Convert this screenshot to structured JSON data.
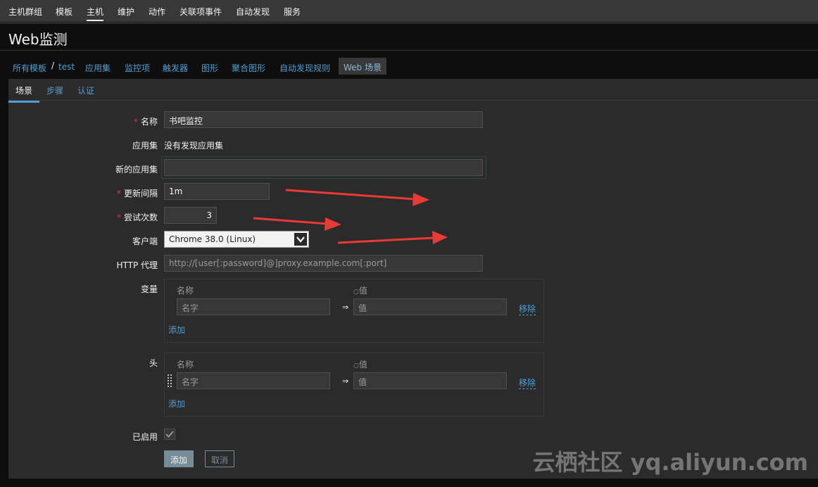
{
  "topnav": {
    "items": [
      "主机群组",
      "模板",
      "主机",
      "维护",
      "动作",
      "关联项事件",
      "自动发现",
      "服务"
    ],
    "active": "主机"
  },
  "page": {
    "title": "Web监测"
  },
  "breadcrumb": {
    "all_templates": "所有模板",
    "separator": "/",
    "current": "test",
    "links": [
      "应用集",
      "监控项",
      "触发器",
      "图形",
      "聚合图形",
      "自动发现规则"
    ],
    "active": "Web 场景"
  },
  "tabs": [
    "场景",
    "步骤",
    "认证"
  ],
  "form": {
    "name_label": "名称",
    "name_value": "书吧监控",
    "appset_label": "应用集",
    "appset_value": "没有发现应用集",
    "new_appset_label": "新的应用集",
    "new_appset_value": "",
    "interval_label": "更新间隔",
    "interval_value": "1m",
    "attempts_label": "尝试次数",
    "attempts_value": "3",
    "client_label": "客户端",
    "client_value": "Chrome 38.0 (Linux)",
    "proxy_label": "HTTP 代理",
    "proxy_placeholder": "http://[user[:password]@]proxy.example.com[:port]",
    "vars_label": "变量",
    "headers_label": "头",
    "col_name": "名称",
    "col_value": "值",
    "name_placeholder": "名字",
    "value_placeholder": "值",
    "remove": "移除",
    "add": "添加",
    "enabled_label": "已启用",
    "enabled": true
  },
  "buttons": {
    "submit": "添加",
    "cancel": "取消"
  },
  "watermark": "云栖社区 yq.aliyun.com",
  "colors": {
    "background": "#2b2b2b",
    "link": "#4f9fd5",
    "required": "#e33734",
    "annotation_arrow": "#e83a36"
  }
}
